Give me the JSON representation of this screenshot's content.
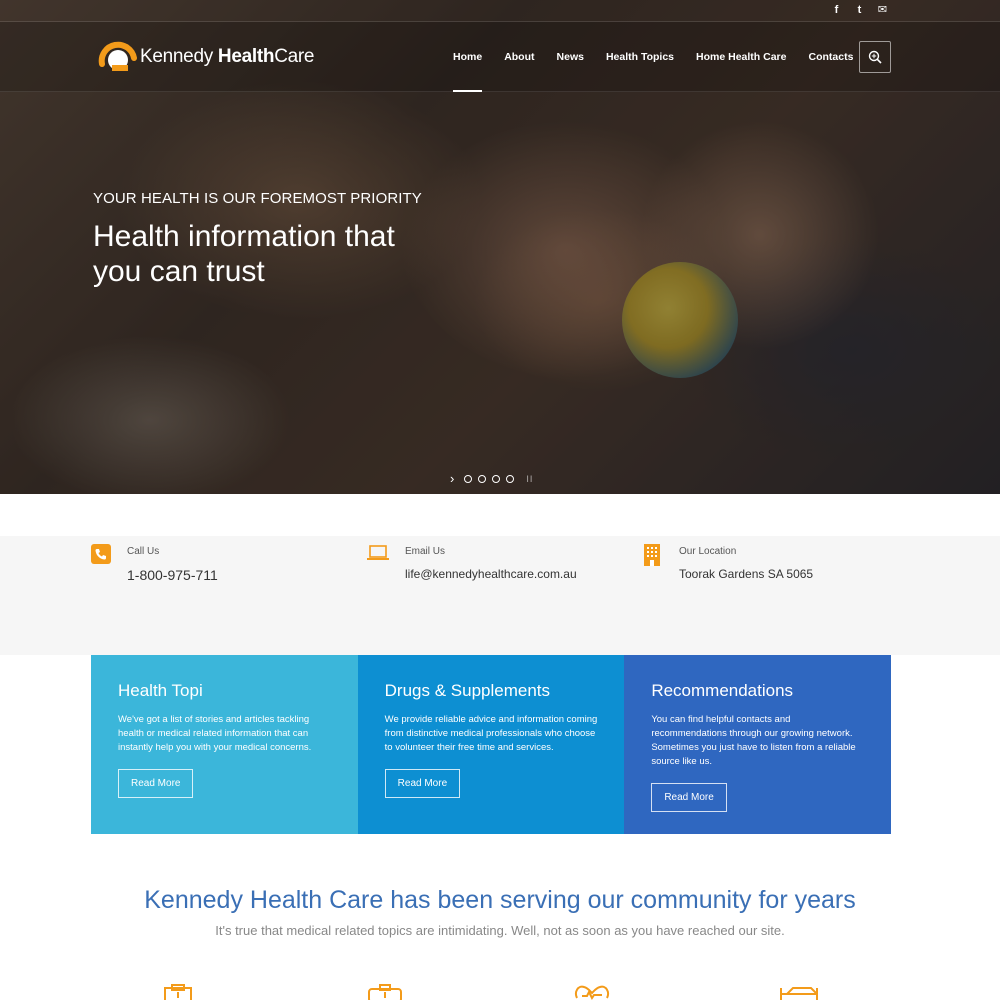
{
  "colors": {
    "accent": "#f39b1a",
    "box1": "#3bb6da",
    "box2": "#0d8fd2",
    "box3": "#2f67c0",
    "heading_blue": "#3a6fb5"
  },
  "topbar": {
    "social": [
      {
        "icon": "facebook-icon",
        "glyph": "f"
      },
      {
        "icon": "twitter-icon",
        "glyph": "t"
      },
      {
        "icon": "envelope-icon",
        "glyph": "✉"
      }
    ]
  },
  "logo": {
    "text_regular": "Kennedy",
    "text_bold": "Health",
    "text_end": "Care"
  },
  "nav": {
    "items": [
      "Home",
      "About",
      "News",
      "Health Topics",
      "Home Health Care",
      "Contacts"
    ],
    "active_index": 0,
    "search_icon": "search-icon"
  },
  "hero": {
    "kicker": "YOUR HEALTH IS OUR FOREMOST PRIORITY",
    "title_line1": "Health information that",
    "title_line2": "you can trust",
    "slides_count": 4,
    "pause_glyph": "II"
  },
  "contact": {
    "call": {
      "label": "Call Us",
      "value": "1-800-975-711",
      "icon": "phone-icon"
    },
    "email": {
      "label": "Email Us",
      "value": "life@kennedyhealthcare.com.au",
      "icon": "laptop-icon"
    },
    "location": {
      "label": "Our Location",
      "value": "Toorak Gardens SA 5065",
      "icon": "building-icon"
    }
  },
  "features": [
    {
      "title": "Health Topi",
      "text": "We've got a list of stories and articles tackling health or medical related information that can instantly help you with your medical concerns.",
      "button": "Read More"
    },
    {
      "title": "Drugs & Supplements",
      "text": "We provide reliable advice and information coming from distinctive medical professionals who choose to volunteer their free time and services.",
      "button": "Read More"
    },
    {
      "title": "Recommendations",
      "text": "You can find helpful contacts and recommendations through our growing network. Sometimes you just have to listen from a reliable source like us.",
      "button": "Read More"
    }
  ],
  "about": {
    "title": "Kennedy Health Care has been serving our community for years",
    "subtitle": "It's true that medical related topics are intimidating. Well, not as soon as you have reached our site."
  },
  "bottom_icons": [
    "clipboard-icon",
    "medical-bag-icon",
    "heart-monitor-icon",
    "hospital-bed-icon"
  ]
}
